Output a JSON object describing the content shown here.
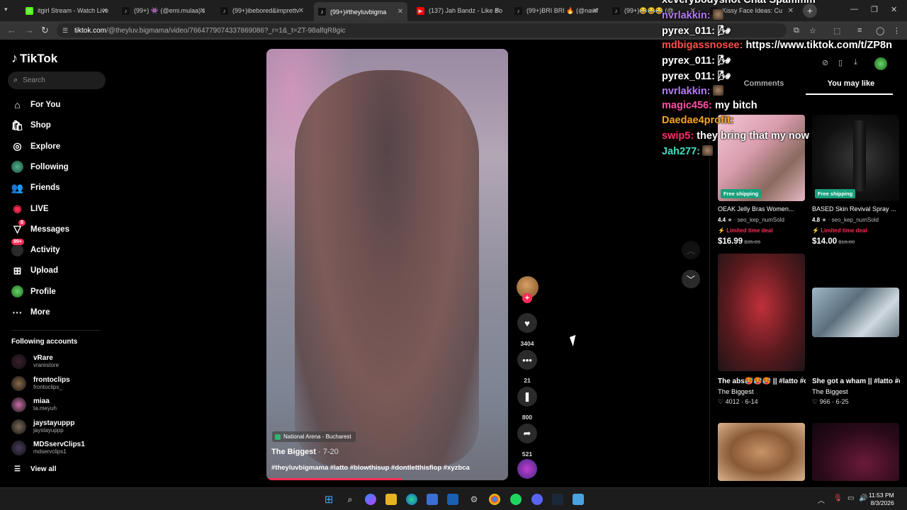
{
  "browser": {
    "tabs": [
      {
        "title": "itgirl Stream - Watch Live",
        "fav_color": "#53fc18",
        "fav_glyph": "K"
      },
      {
        "title": "(99+) 👾 (@emi.mulaa)'s",
        "fav_color": "#111",
        "fav_glyph": "♪"
      },
      {
        "title": "(99+)ibebored&imprettv",
        "fav_color": "#111",
        "fav_glyph": "♪"
      },
      {
        "title": "(99+)#theyluvbigma",
        "fav_color": "#111",
        "fav_glyph": "♪"
      },
      {
        "title": "(137) Jah Bandz - Like Bo",
        "fav_color": "#ff0000",
        "fav_glyph": "▶"
      },
      {
        "title": "(99+)BRI BRI 🔥 (@nawf",
        "fav_color": "#111",
        "fav_glyph": "♪"
      },
      {
        "title": "(99+)😂😂😂 (@",
        "fav_color": "#111",
        "fav_glyph": "♪"
      },
      {
        "title": "Kissy Face Ideas: Cu",
        "fav_color": "#111",
        "fav_glyph": "♪"
      }
    ],
    "url_host": "tiktok.com",
    "url_path": "/@theyluv.bigmama/video/7664779074337869086?_r=1&_t=ZT-98alfqR8gic"
  },
  "sidebar": {
    "logo": "TikTok",
    "search_placeholder": "Search",
    "nav": [
      {
        "label": "For You",
        "icon": "home-icon",
        "glyph": "⌂"
      },
      {
        "label": "Shop",
        "icon": "shop-icon",
        "glyph": "🛍"
      },
      {
        "label": "Explore",
        "icon": "compass-icon",
        "glyph": "◎"
      },
      {
        "label": "Following",
        "icon": "following-avatar-icon",
        "glyph": ""
      },
      {
        "label": "Friends",
        "icon": "friends-icon",
        "glyph": "👥"
      },
      {
        "label": "LIVE",
        "icon": "live-icon",
        "glyph": "◉"
      },
      {
        "label": "Messages",
        "icon": "messages-icon",
        "glyph": "▽"
      },
      {
        "label": "Activity",
        "icon": "activity-icon",
        "glyph": ""
      },
      {
        "label": "Upload",
        "icon": "upload-icon",
        "glyph": "⊞"
      },
      {
        "label": "Profile",
        "icon": "profile-avatar-icon",
        "glyph": ""
      },
      {
        "label": "More",
        "icon": "more-icon",
        "glyph": "···"
      }
    ],
    "messages_badge": "8",
    "activity_badge": "99+",
    "following_title": "Following accounts",
    "accounts": [
      {
        "name": "vRare",
        "handle": "vrarestore",
        "color": "#3a1d2c"
      },
      {
        "name": "frontoclips",
        "handle": "frontoclips_",
        "color": "#8a6a4a"
      },
      {
        "name": "miaa",
        "handle": "ta.meyuh",
        "color": "#c96fa6"
      },
      {
        "name": "jaystayuppp",
        "handle": "jaystayuppp",
        "color": "#7a6a58"
      },
      {
        "name": "MDSservClips1",
        "handle": "mdservclips1",
        "color": "#4a3a5a"
      }
    ],
    "view_all": "View all"
  },
  "video": {
    "location": "National Arena - Bucharest",
    "author": "The Biggest",
    "date": "· 7-20",
    "tags": "#theyluvbigmama #latto #blowthisup #dontletthisflop #xyzbca",
    "progress": 0.56
  },
  "actions": {
    "likes": "3404",
    "comments": "21",
    "saves": "800",
    "shares": "521"
  },
  "panel": {
    "tab_comments": "Comments",
    "tab_you_may_like": "You may like",
    "products": [
      {
        "name": "OEAK Jelly Bras Women...",
        "rating": "4.4",
        "sold": "· seo_kep_numSold",
        "deal": "Limited time deal",
        "price": "$16.99",
        "old_price": "$35.99",
        "badge": "Free shipping"
      },
      {
        "name": "BASED Skin Revival Spray ...",
        "rating": "4.8",
        "sold": "· seo_kep_numSold",
        "deal": "Limited time deal",
        "price": "$14.00",
        "old_price": "$18.00",
        "badge": "Free shipping"
      }
    ],
    "videos": [
      {
        "title": "The abs🥵🥵🥵 || #latto #dontletthisflo...",
        "author": "The Biggest",
        "likes": "♡ 4012",
        "date": "· 6-14"
      },
      {
        "title": "She got a wham || #latto #dontletthisflo...",
        "author": "The Biggest",
        "likes": "♡ 966",
        "date": "· 6-25"
      }
    ]
  },
  "chat": [
    {
      "user": "xeverybodyshot",
      "color": "#ffffff",
      "msg": " Chat Spammm"
    },
    {
      "user": "nvrlakkin:",
      "color": "#b57cf6",
      "msg": "",
      "emote": true
    },
    {
      "user": "pyrex_011:",
      "color": "#ffffff",
      "msg": " 🌬"
    },
    {
      "user": "mdbigassnosee:",
      "color": "#ff4d4d",
      "msg": " https://www.tiktok.com/t/ZP8n"
    },
    {
      "user": "pyrex_011:",
      "color": "#ffffff",
      "msg": " 🌬"
    },
    {
      "user": "pyrex_011:",
      "color": "#ffffff",
      "msg": " 🌬"
    },
    {
      "user": "nvrlakkin:",
      "color": "#b57cf6",
      "msg": "",
      "emote": true
    },
    {
      "user": "magic456:",
      "color": "#ff4fa3",
      "msg": " my bitch"
    },
    {
      "user": "Daedae4profit:",
      "color": "#f5a623",
      "msg": ""
    },
    {
      "user": "swip5:",
      "color": "#ff2f6e",
      "msg": " they bring that my now"
    },
    {
      "user": "Jah277:",
      "color": "#3fe0c0",
      "msg": "",
      "emote": true
    }
  ],
  "taskbar": {
    "time": "11:53 PM",
    "date": "8/3/2026"
  }
}
